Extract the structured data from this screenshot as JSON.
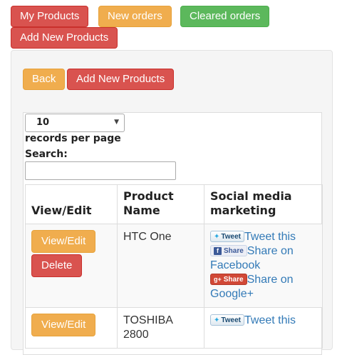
{
  "nav": {
    "my_products": "My Products",
    "new_orders": "New orders",
    "cleared_orders": "Cleared orders",
    "add_new_products": "Add New Products"
  },
  "actions": {
    "back": "Back",
    "add_new_products": "Add New Products"
  },
  "table_controls": {
    "page_length": "10",
    "records_label": "records per page",
    "search_label": "Search:",
    "search_value": ""
  },
  "table": {
    "headers": [
      "View/Edit",
      "Product Name",
      "Social media marketing"
    ],
    "rows": [
      {
        "view_edit": "View/Edit",
        "delete": "Delete",
        "product_name": "HTC One",
        "tweet_button": "Tweet",
        "tweet_link": "Tweet this",
        "fb_button": "Share",
        "fb_link": "Share on Facebook",
        "gplus_button": "Share",
        "gplus_link": "Share on Google+"
      },
      {
        "view_edit": "View/Edit",
        "product_name": "TOSHIBA 2800",
        "tweet_button": "Tweet",
        "tweet_link": "Tweet this"
      }
    ]
  },
  "colors": {
    "danger": "#d9534f",
    "warning": "#f0ad4e",
    "success": "#5cb85c",
    "link": "#337ab7"
  },
  "icons": {
    "twitter": "twitter-bird-icon",
    "facebook": "facebook-icon",
    "google_plus": "google-plus-icon",
    "select_caret": "chevron-down-icon"
  }
}
